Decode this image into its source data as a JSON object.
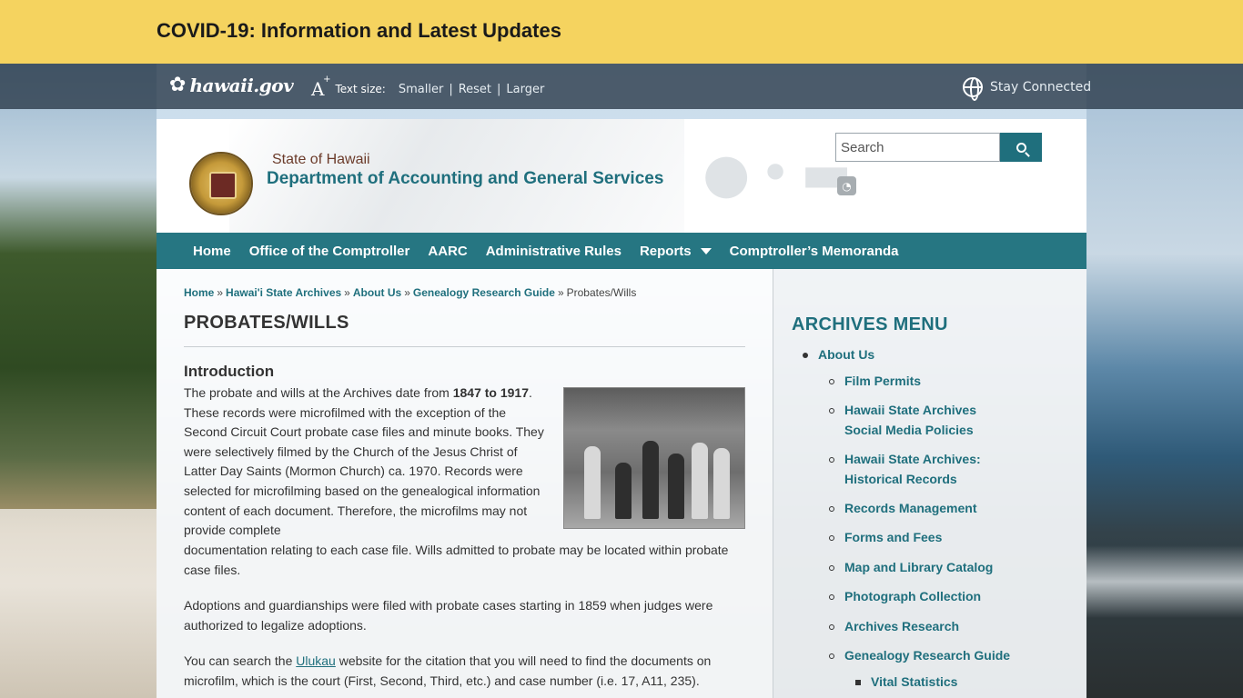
{
  "banner": {
    "title": "COVID-19: Information and Latest Updates"
  },
  "utility": {
    "logo_text": "hawaii.gov",
    "text_size_label": "Text size:",
    "smaller": "Smaller",
    "reset": "Reset",
    "larger": "Larger",
    "separator": "|",
    "stay_connected": "Stay Connected"
  },
  "header": {
    "state": "State of Hawaii",
    "department": "Department of Accounting and General Services",
    "search_placeholder": "Search"
  },
  "nav": {
    "items": [
      {
        "label": "Home"
      },
      {
        "label": "Office of the Comptroller"
      },
      {
        "label": "AARC"
      },
      {
        "label": "Administrative Rules"
      },
      {
        "label": "Reports"
      },
      {
        "label": "Comptroller’s Memoranda"
      }
    ]
  },
  "breadcrumb": {
    "items": [
      "Home",
      "Hawai'i State Archives",
      "About Us",
      "Genealogy Research Guide"
    ],
    "current": "Probates/Wills",
    "separator": "»"
  },
  "main": {
    "title": "PROBATES/WILLS",
    "intro_heading": "Introduction",
    "p1_a": "The probate and wills at the Archives date from ",
    "p1_bold": "1847 to 1917",
    "p1_b": ".  These records were microfilmed with the exception of the Second Circuit Court probate case files and minute books.  They were selectively filmed by the Church of the Jesus Christ of Latter Day Saints (Mormon Church) ca. 1970.  Records were selected for microfilming based on the genealogical information content of each document.  Therefore, the microfilms may not provide complete",
    "p1_c": "documentation relating to each case file.  Wills admitted to probate may be located within probate case files.",
    "p2": "Adoptions and guardianships were filed with probate cases starting in 1859 when judges were authorized to legalize adoptions.",
    "p3_a": "You can search the ",
    "p3_link": "Ulukau",
    "p3_b": " website for the citation that you will need to find the documents on microfilm, which is the court (First, Second, Third, etc.) and case number (i.e. 17, A11, 235)."
  },
  "sidebar": {
    "title": "ARCHIVES MENU",
    "top": "About Us",
    "sub": [
      "Film Permits",
      "Hawaii State Archives",
      "Social Media Policies",
      "Hawaii State Archives:",
      "Historical Records",
      "Records Management",
      "Forms and Fees",
      "Map and Library Catalog",
      "Photograph Collection",
      "Archives Research",
      "Genealogy Research Guide"
    ],
    "subsub": "Vital Statistics"
  },
  "colors": {
    "teal": "#1f6f7d",
    "nav": "#267682",
    "banner": "#f5d35f",
    "brown": "#6b3b2a"
  },
  "icons": {
    "logo": "hibiscus-icon",
    "text_size": "text-size-icon",
    "stay_connected": "globe-icon",
    "search": "search-icon",
    "rss": "rss-icon",
    "dropdown": "caret-down-icon"
  }
}
